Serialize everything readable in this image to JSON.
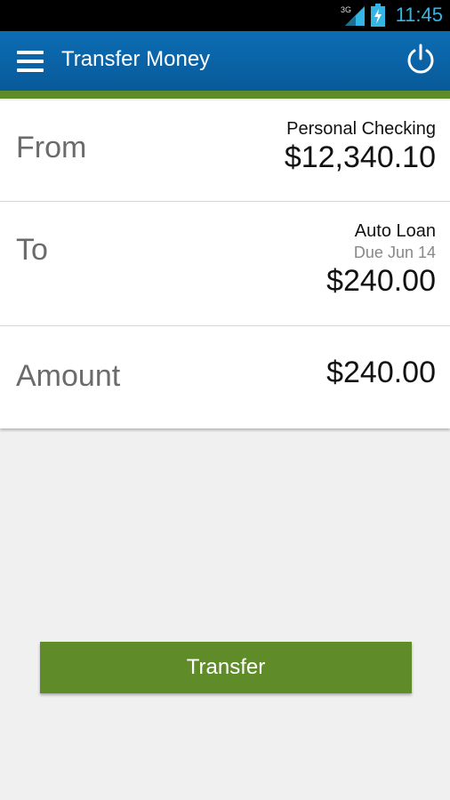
{
  "status_bar": {
    "network": "3G",
    "time": "11:45",
    "icons": [
      "signal-icon",
      "battery-charging-icon"
    ]
  },
  "app_bar": {
    "title": "Transfer Money",
    "icons": [
      "menu-icon",
      "power-icon"
    ]
  },
  "from": {
    "label": "From",
    "account": "Personal Checking",
    "amount": "$12,340.10"
  },
  "to": {
    "label": "To",
    "account": "Auto Loan",
    "due": "Due Jun 14",
    "amount": "$240.00"
  },
  "amount": {
    "label": "Amount",
    "value": "$240.00"
  },
  "actions": {
    "transfer_label": "Transfer"
  },
  "colors": {
    "header_blue": "#085a99",
    "accent_green": "#5f8b28",
    "status_blue": "#33b5e5"
  }
}
